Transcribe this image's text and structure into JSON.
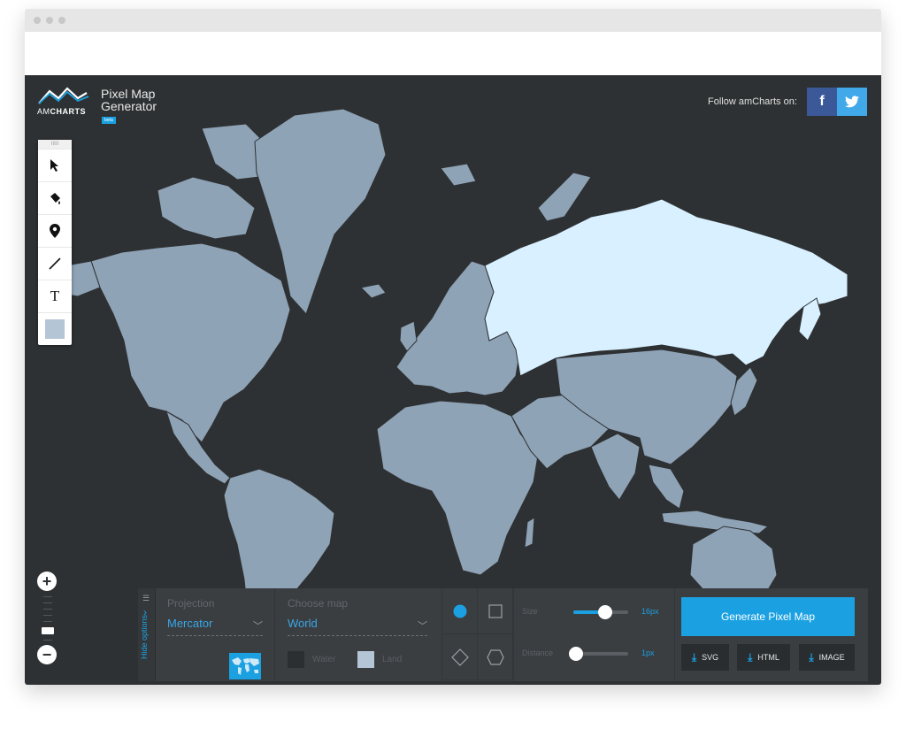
{
  "header": {
    "logo_light": "AM",
    "logo_bold": "CHARTS",
    "title_line1": "Pixel Map",
    "title_line2": "Generator",
    "badge": "beta",
    "follow_label": "Follow amCharts on:"
  },
  "social": {
    "facebook_glyph": "f",
    "twitter_glyph": "t"
  },
  "toolbar": {
    "grip": "IIIII",
    "tools": [
      "cursor-icon",
      "fill-bucket-icon",
      "map-pin-icon",
      "line-icon",
      "text-icon",
      "color-swatch"
    ],
    "text_glyph": "T",
    "swatch_color": "#b4c5d6"
  },
  "zoom": {
    "plus": "+",
    "minus": "−"
  },
  "panel": {
    "hide_label": "Hide options",
    "projection": {
      "label": "Projection",
      "value": "Mercator"
    },
    "map": {
      "label": "Choose map",
      "value": "World"
    },
    "water_label": "Water",
    "land_label": "Land",
    "water_color": "#2b2f31",
    "land_color": "#b4c5d6",
    "size": {
      "label": "Size",
      "value": "16px",
      "fraction": 0.55
    },
    "distance": {
      "label": "Distance",
      "value": "1px",
      "fraction": 0.02
    },
    "generate_label": "Generate Pixel Map",
    "downloads": [
      "SVG",
      "HTML",
      "IMAGE"
    ]
  },
  "colors": {
    "accent": "#1ba1e2",
    "background": "#2e3133",
    "land": "#8fa3b6",
    "highlight": "#d8f0ff",
    "facebook": "#3b5998",
    "twitter": "#41a9ea"
  }
}
